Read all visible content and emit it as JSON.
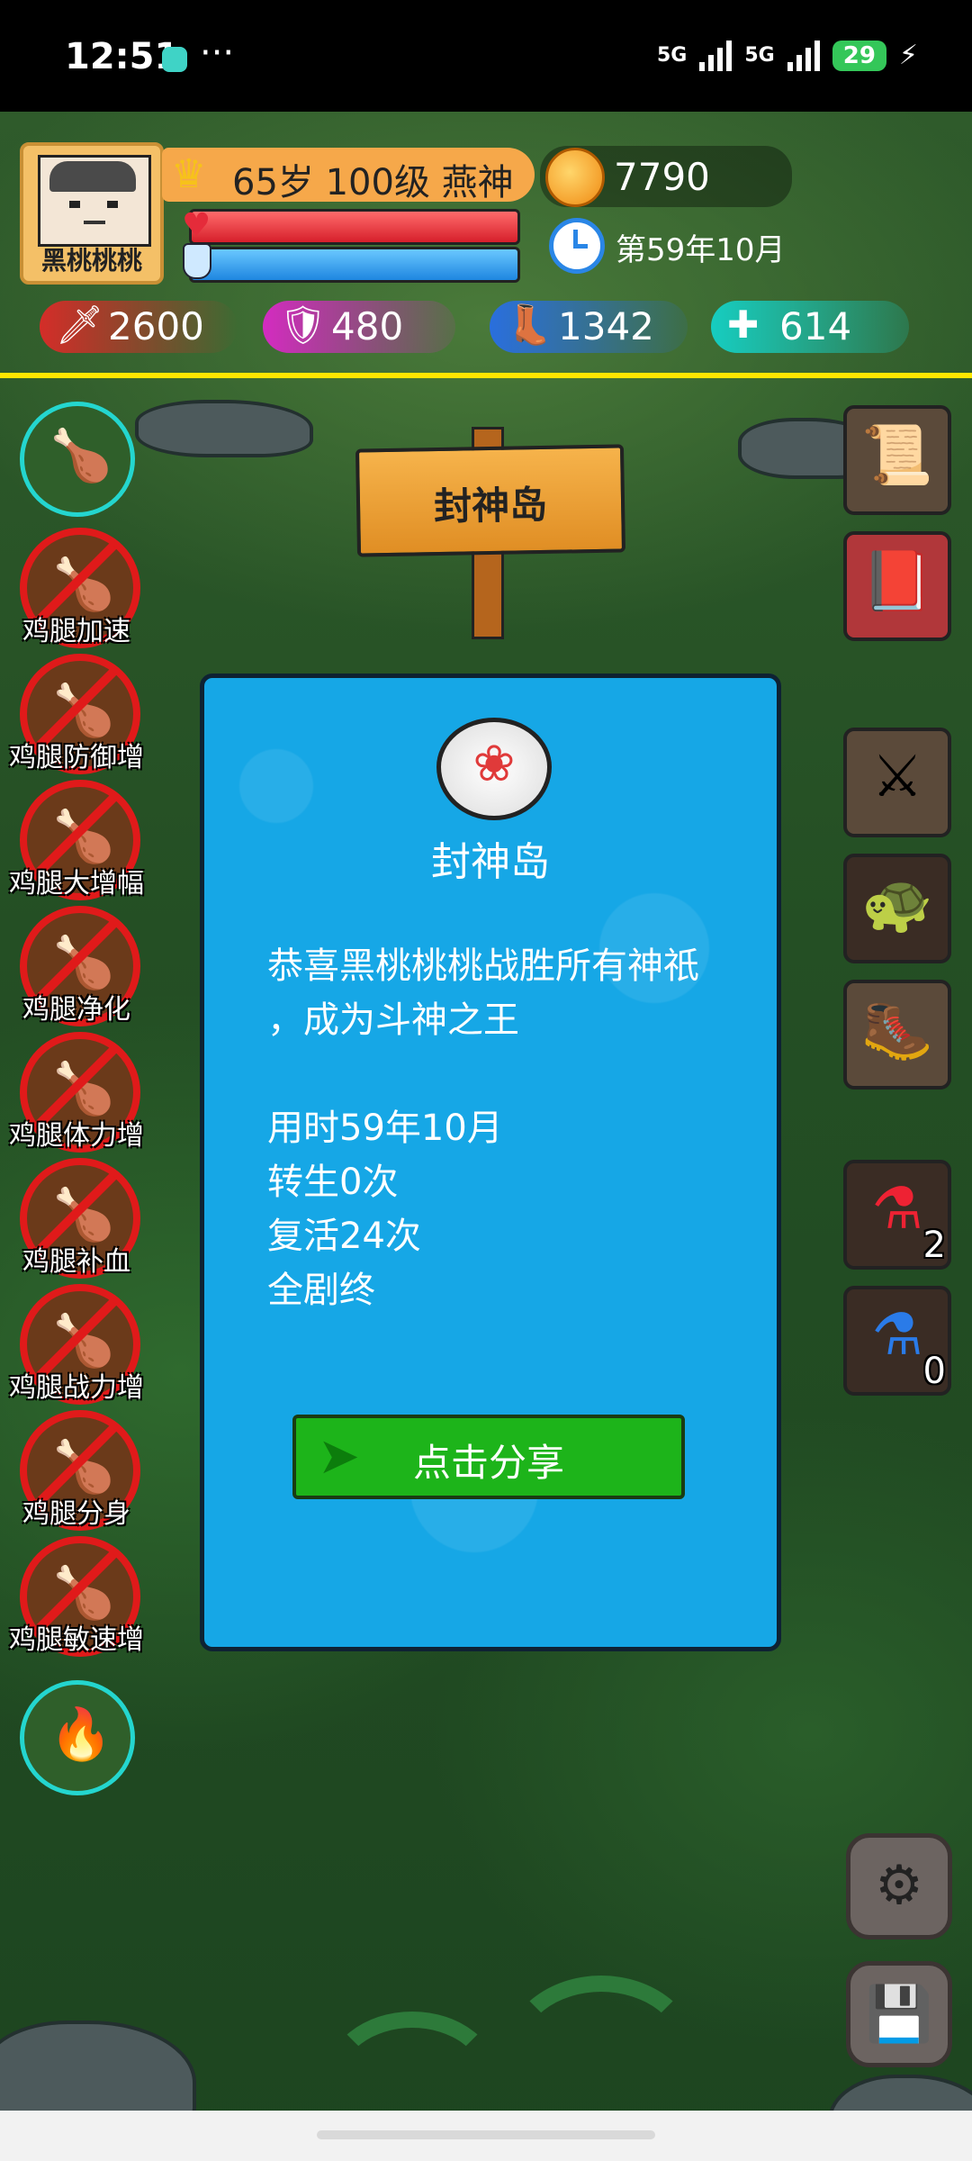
{
  "status_bar": {
    "time": "12:51",
    "overflow": "···",
    "signal1": "5G",
    "signal2": "5G",
    "battery": "29"
  },
  "player": {
    "name": "黑桃桃桃",
    "level_title": "65岁 100级 燕神",
    "gold": "7790",
    "date": "第59年10月"
  },
  "stats": {
    "attack": "2600",
    "defense": "480",
    "speed": "1342",
    "health": "614"
  },
  "sign": {
    "text": "封神岛"
  },
  "buffs": [
    {
      "label": "鸡腿加速"
    },
    {
      "label": "鸡腿防御增"
    },
    {
      "label": "鸡腿大增幅"
    },
    {
      "label": "鸡腿净化"
    },
    {
      "label": "鸡腿体力增"
    },
    {
      "label": "鸡腿补血"
    },
    {
      "label": "鸡腿战力增"
    },
    {
      "label": "鸡腿分身"
    },
    {
      "label": "鸡腿敏速增"
    }
  ],
  "items": {
    "red_potion_count": "2",
    "blue_potion_count": "0"
  },
  "dialog": {
    "title": "封神岛",
    "line1": "恭喜黑桃桃桃战胜所有神祇",
    "line2": "，成为斗神之王",
    "time_used": "用时59年10月",
    "rebirths": "转生0次",
    "revives": "复活24次",
    "ending": "全剧终",
    "share_label": "点击分享"
  },
  "icons": {
    "gold": "coin-icon",
    "time": "clock-icon",
    "attack": "sword-icon",
    "defense": "shield-icon",
    "speed": "boot-icon",
    "health": "heart-plus-icon",
    "settings": "gear-icon",
    "save": "floppy-icon"
  },
  "colors": {
    "divider": "#ffe600",
    "dialog_bg": "#16a7e6",
    "share_button": "#1db41a",
    "buff_disabled": "#e01a1a",
    "buff_active": "#24d6cf"
  }
}
